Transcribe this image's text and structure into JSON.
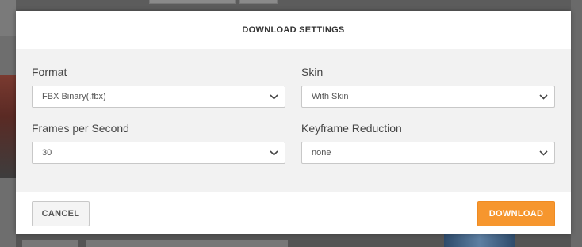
{
  "dialog": {
    "title": "DOWNLOAD SETTINGS",
    "fields": {
      "format": {
        "label": "Format",
        "value": "FBX Binary(.fbx)"
      },
      "skin": {
        "label": "Skin",
        "value": "With Skin"
      },
      "fps": {
        "label": "Frames per Second",
        "value": "30"
      },
      "keyframe": {
        "label": "Keyframe Reduction",
        "value": "none"
      }
    },
    "buttons": {
      "cancel": "CANCEL",
      "download": "DOWNLOAD"
    }
  },
  "colors": {
    "accent": "#f6962e",
    "body_bg": "#f2f2f2",
    "overlay": "#5c5c5c"
  }
}
